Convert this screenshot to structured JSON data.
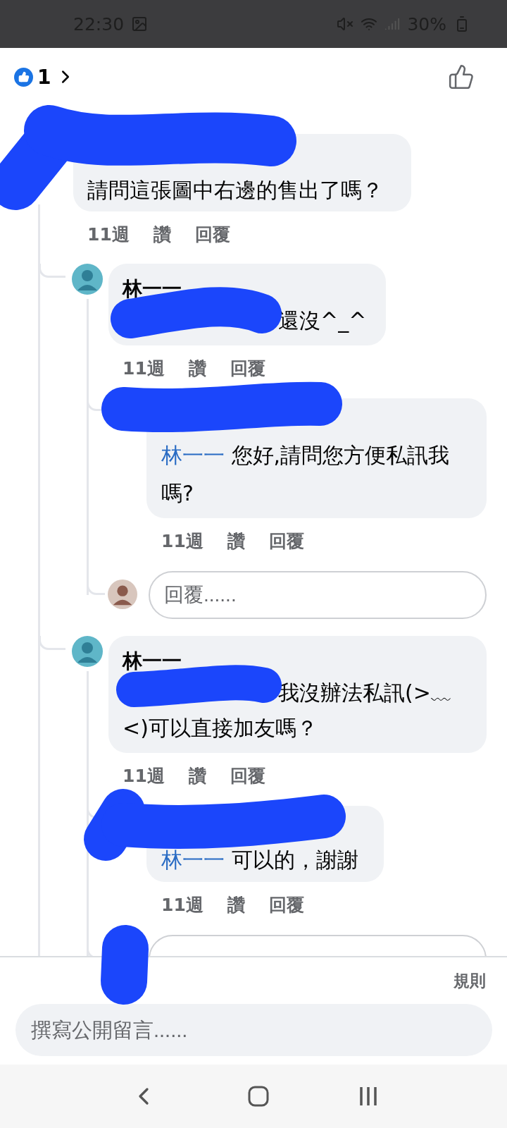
{
  "status_bar": {
    "time": "22:30",
    "battery": "30%"
  },
  "reactions": {
    "count": "1"
  },
  "comment": {
    "author_redacted": true,
    "text": "請問這張圖中右邊的售出了嗎？",
    "actions": {
      "time": "11週",
      "like": "讚",
      "reply": "回覆"
    },
    "replies": [
      {
        "author": "林一一",
        "text_redacted": true,
        "text": "還沒^_^",
        "actions": {
          "time": "11週",
          "like": "讚",
          "reply": "回覆"
        },
        "replies": [
          {
            "author_redacted": true,
            "mention": "林一一",
            "text": "您好,請問您方便私訊我嗎?",
            "actions": {
              "time": "11週",
              "like": "讚",
              "reply": "回覆"
            }
          }
        ],
        "reply_box": {
          "avatar_redacted": false,
          "placeholder": "回覆......"
        }
      },
      {
        "author": "林一一",
        "text_redacted": true,
        "text": "我沒辦法私訊(>﹏<)可以直接加友嗎？",
        "actions": {
          "time": "11週",
          "like": "讚",
          "reply": "回覆"
        },
        "replies": [
          {
            "author_redacted": true,
            "mention": "林一一",
            "text": "可以的，謝謝",
            "actions": {
              "time": "11週",
              "like": "讚",
              "reply": "回覆"
            }
          }
        ],
        "reply_box": {
          "avatar_redacted": true
        }
      }
    ]
  },
  "footer": {
    "rules_link": "規則",
    "compose": {
      "placeholder": "撰寫公開留言......"
    }
  }
}
